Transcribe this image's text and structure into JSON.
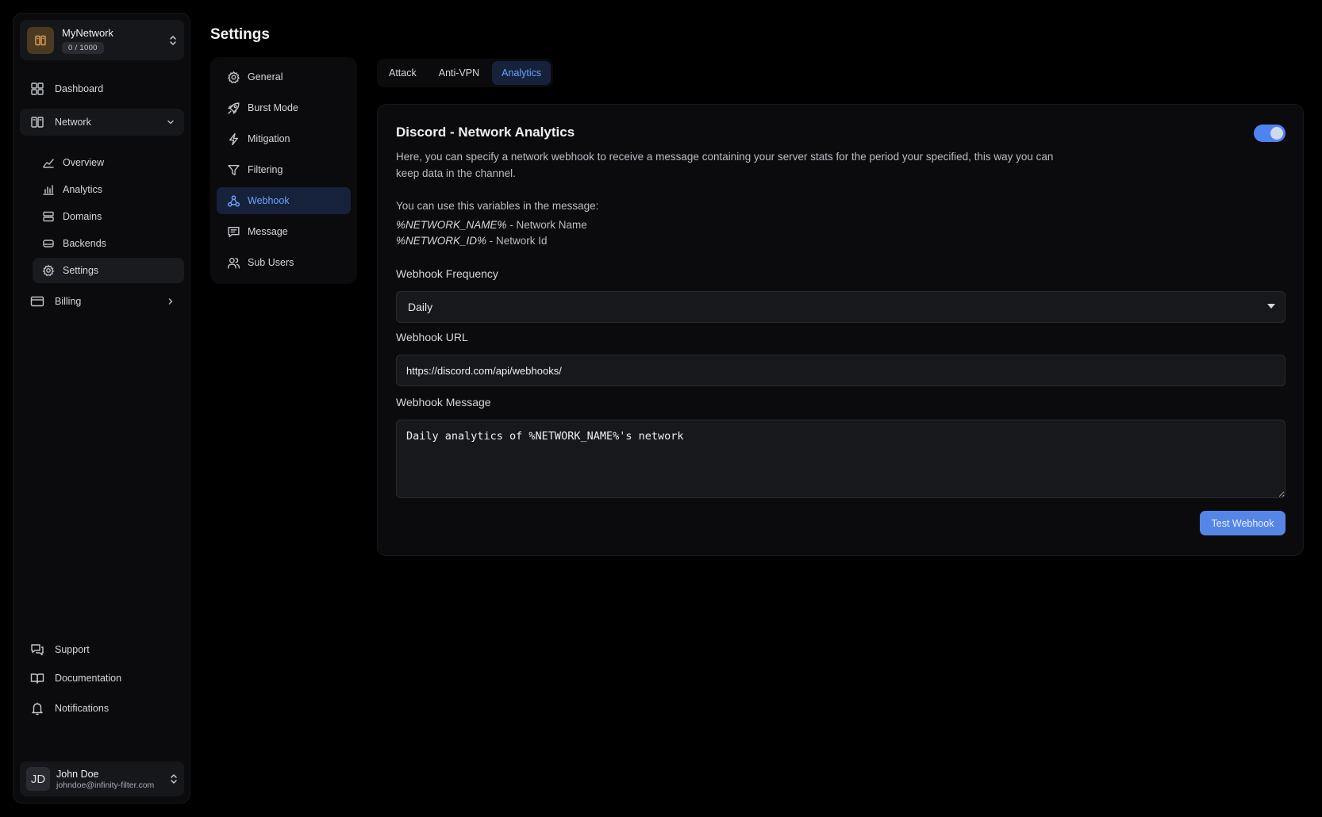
{
  "network": {
    "name": "MyNetwork",
    "count": "0 / 1000"
  },
  "sidebar": {
    "dashboard": "Dashboard",
    "network": "Network",
    "sub": {
      "overview": "Overview",
      "analytics": "Analytics",
      "domains": "Domains",
      "backends": "Backends",
      "settings": "Settings"
    },
    "billing": "Billing",
    "support": "Support",
    "documentation": "Documentation",
    "notifications": "Notifications"
  },
  "user": {
    "initials": "JD",
    "name": "John Doe",
    "email": "johndoe@infinity-filter.com"
  },
  "page": {
    "title": "Settings"
  },
  "settings_nav": {
    "general": "General",
    "burst_mode": "Burst Mode",
    "mitigation": "Mitigation",
    "filtering": "Filtering",
    "webhook": "Webhook",
    "message": "Message",
    "sub_users": "Sub Users"
  },
  "tabs": {
    "attack": "Attack",
    "anti_vpn": "Anti-VPN",
    "analytics": "Analytics"
  },
  "card": {
    "title": "Discord - Network Analytics",
    "enabled": true,
    "description": "Here, you can specify a network webhook to receive a message containing your server stats for the period your specified, this way you can keep data in the channel.",
    "vars_intro": "You can use this variables in the message:",
    "vars": [
      {
        "name": "%NETWORK_NAME%",
        "desc": " - Network Name"
      },
      {
        "name": "%NETWORK_ID%",
        "desc": " - Network Id"
      }
    ],
    "frequency_label": "Webhook Frequency",
    "frequency_value": "Daily",
    "url_label": "Webhook URL",
    "url_value": "https://discord.com/api/webhooks/",
    "message_label": "Webhook Message",
    "message_value": "Daily analytics of %NETWORK_NAME%'s network",
    "test_button": "Test Webhook"
  },
  "colors": {
    "background": "#000000",
    "panel": "#0b0b0d",
    "accent": "#5586e6",
    "active_text": "#6ea1ff"
  }
}
